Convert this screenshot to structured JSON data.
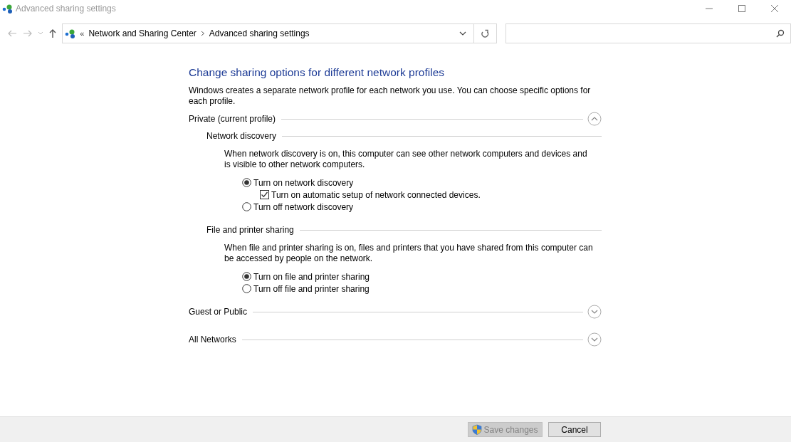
{
  "window": {
    "title": "Advanced sharing settings"
  },
  "address_bar": {
    "overflow": "«",
    "breadcrumbs": [
      "Network and Sharing Center",
      "Advanced sharing settings"
    ]
  },
  "heading": "Change sharing options for different network profiles",
  "intro": "Windows creates a separate network profile for each network you use. You can choose specific options for each profile.",
  "profiles": [
    {
      "label": "Private (current profile)",
      "expanded": true,
      "sections": [
        {
          "title": "Network discovery",
          "description": "When network discovery is on, this computer can see other network computers and devices and is visible to other network computers.",
          "options": [
            {
              "kind": "radio",
              "label": "Turn on network discovery",
              "selected": true,
              "children": [
                {
                  "kind": "checkbox",
                  "label": "Turn on automatic setup of network connected devices.",
                  "checked": true
                }
              ]
            },
            {
              "kind": "radio",
              "label": "Turn off network discovery",
              "selected": false
            }
          ]
        },
        {
          "title": "File and printer sharing",
          "description": "When file and printer sharing is on, files and printers that you have shared from this computer can be accessed by people on the network.",
          "options": [
            {
              "kind": "radio",
              "label": "Turn on file and printer sharing",
              "selected": true
            },
            {
              "kind": "radio",
              "label": "Turn off file and printer sharing",
              "selected": false
            }
          ]
        }
      ]
    },
    {
      "label": "Guest or Public",
      "expanded": false
    },
    {
      "label": "All Networks",
      "expanded": false
    }
  ],
  "buttons": [
    {
      "label": "Save changes",
      "disabled": true,
      "shield": true
    },
    {
      "label": "Cancel",
      "disabled": false,
      "shield": false
    }
  ]
}
